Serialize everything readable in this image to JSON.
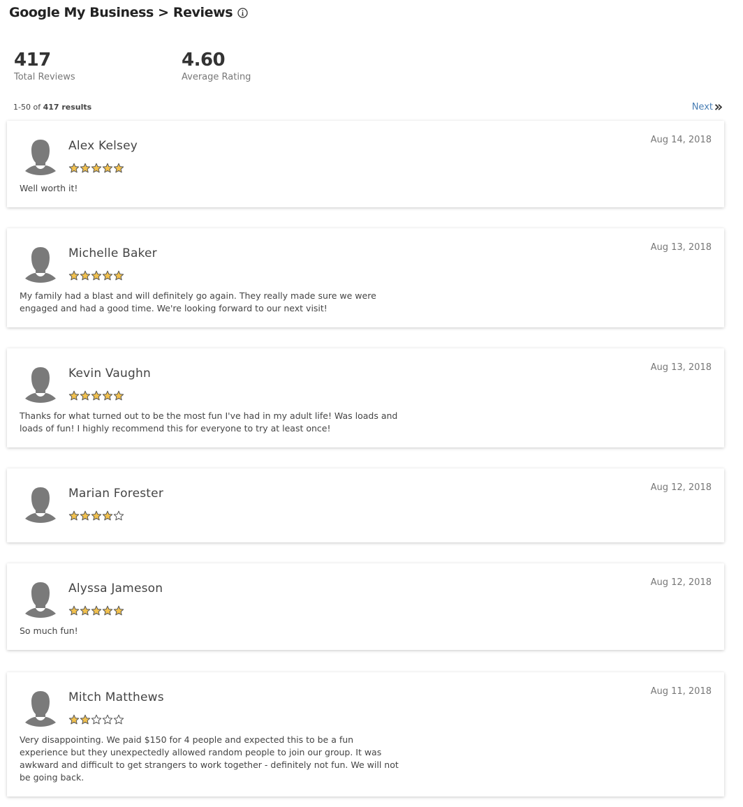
{
  "header": {
    "title": "Google My Business > Reviews",
    "info_icon": "info-circle-icon"
  },
  "stats": {
    "total_reviews_value": "417",
    "total_reviews_label": "Total Reviews",
    "average_rating_value": "4.60",
    "average_rating_label": "Average Rating"
  },
  "results": {
    "range": "1-50 of ",
    "total": "417 results",
    "next_label": "Next",
    "next_icon": "double-chevron-right-icon"
  },
  "colors": {
    "star_fill": "#f2c14e",
    "star_stroke": "#555555",
    "avatar": "#7a7a7a",
    "link": "#4a7fb5"
  },
  "reviews": [
    {
      "name": "Alex Kelsey",
      "date": "Aug 14, 2018",
      "rating": 5,
      "text": "Well worth it!"
    },
    {
      "name": "Michelle Baker",
      "date": "Aug 13, 2018",
      "rating": 5,
      "text": "My family had a blast and will definitely go again. They really made sure we were engaged and had a good time. We're looking forward to our next visit!"
    },
    {
      "name": "Kevin Vaughn",
      "date": "Aug 13, 2018",
      "rating": 5,
      "text": "Thanks for what turned out to be the most fun I've had in my adult life! Was loads and loads of fun! I highly recommend this for everyone to try at least once!"
    },
    {
      "name": "Marian Forester",
      "date": "Aug 12, 2018",
      "rating": 4,
      "text": ""
    },
    {
      "name": "Alyssa Jameson",
      "date": "Aug 12, 2018",
      "rating": 5,
      "text": "So much fun!"
    },
    {
      "name": "Mitch Matthews",
      "date": "Aug 11, 2018",
      "rating": 2,
      "text": "Very disappointing. We paid $150 for 4 people and expected this to be a fun experience but they unexpectedly allowed random people to join our group. It was awkward and difficult to get strangers to work together - definitely not fun. We will not be going back."
    }
  ]
}
